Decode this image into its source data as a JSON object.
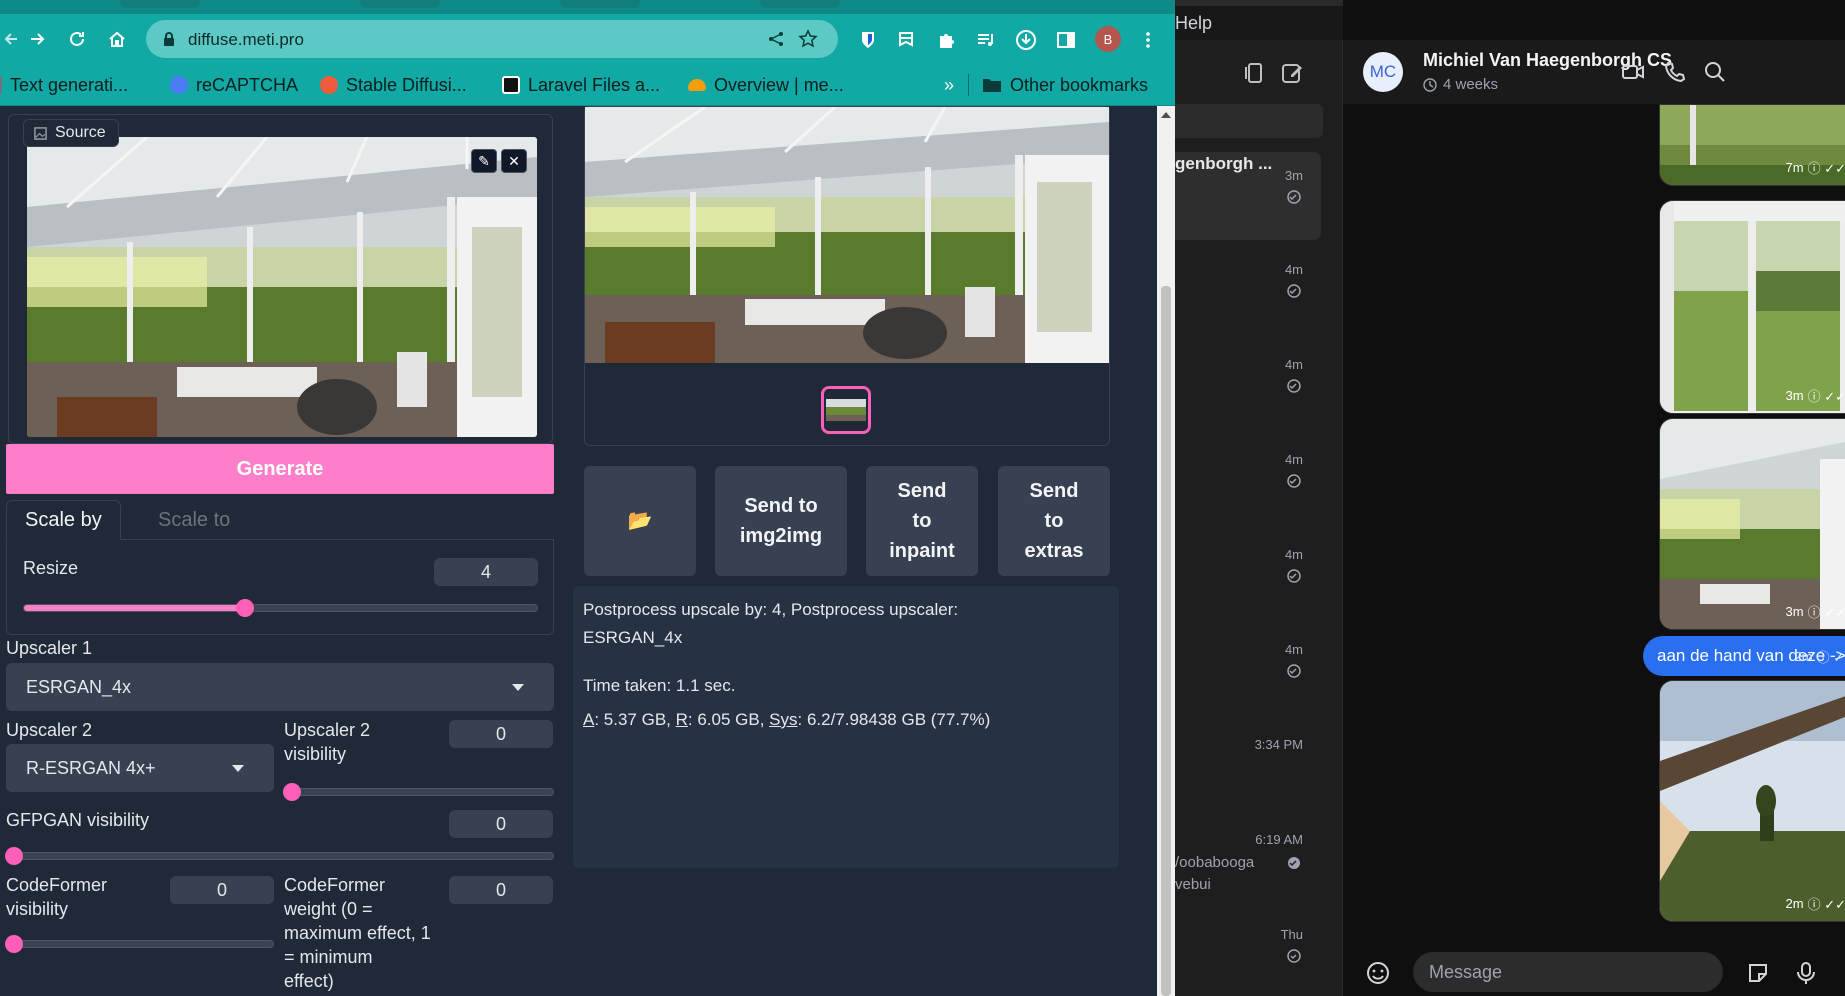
{
  "browser": {
    "url": "diffuse.meti.pro",
    "profile_initial": "B",
    "bookmarks": [
      {
        "label": "Text generati...",
        "color": "#6b7280"
      },
      {
        "label": "reCAPTCHA",
        "color": "#4a7bf2"
      },
      {
        "label": "Stable Diffusi...",
        "color": "#ef5b3d"
      },
      {
        "label": "Laravel Files a...",
        "color": "#111111"
      },
      {
        "label": "Overview | me...",
        "color": "#f59e0b"
      }
    ],
    "bookmarks_more": "»",
    "other_bookmarks": "Other bookmarks"
  },
  "webui": {
    "source_label": "Source",
    "generate_label": "Generate",
    "tabs": [
      "Scale by",
      "Scale to"
    ],
    "resize": {
      "label": "Resize",
      "value": "4",
      "level": 0.43
    },
    "upscaler1": {
      "label": "Upscaler 1",
      "value": "ESRGAN_4x"
    },
    "upscaler2": {
      "label": "Upscaler 2",
      "value": "R-ESRGAN 4x+"
    },
    "upscaler2_visibility": {
      "label_line1": "Upscaler 2",
      "label_line2": "visibility",
      "value": "0",
      "level": 0
    },
    "gfpgan": {
      "label": "GFPGAN visibility",
      "value": "0",
      "level": 0
    },
    "codeformer_vis": {
      "label_line1": "CodeFormer",
      "label_line2": "visibility",
      "value": "0",
      "level": 0
    },
    "codeformer_weight": {
      "label_lines": [
        "CodeFormer",
        "weight (0 =",
        "maximum effect, 1",
        "= minimum",
        "effect)"
      ],
      "value": "0"
    },
    "folder_icon": "📂",
    "actions": [
      {
        "line1": "Send to",
        "line2": "img2img",
        "line3": ""
      },
      {
        "line1": "Send",
        "line2": "to",
        "line3": "inpaint"
      },
      {
        "line1": "Send",
        "line2": "to",
        "line3": "extras"
      }
    ],
    "info_line1": "Postprocess upscale by: 4, Postprocess upscaler:",
    "info_line2": "ESRGAN_4x",
    "time_taken": "Time taken: 1.1 sec.",
    "mem": {
      "a_key": "A",
      "a_val": ": 5.37 GB, ",
      "r_key": "R",
      "r_val": ": 6.05 GB, ",
      "sys_key": "Sys",
      "sys_val": ": 6.2/7.98438 GB (77.7%)"
    }
  },
  "telegram": {
    "menu_help": "Help",
    "contact_name": "Michiel Van Haegenborgh CS",
    "avatar_initials": "MC",
    "status": "4 weeks",
    "chat_list": [
      {
        "name": "genborgh ...",
        "time": "3m",
        "preview": ""
      },
      {
        "name": "",
        "time": "4m",
        "preview": ""
      },
      {
        "name": "",
        "time": "4m",
        "preview": ""
      },
      {
        "name": "",
        "time": "4m",
        "preview": ""
      },
      {
        "name": "",
        "time": "4m",
        "preview": ""
      },
      {
        "name": "",
        "time": "4m",
        "preview": ""
      },
      {
        "name": "",
        "time": "3:34 PM",
        "preview": ""
      },
      {
        "name": "",
        "time": "6:19 AM",
        "preview": "/oobabooga",
        "preview2": "vebui"
      },
      {
        "name": "",
        "time": "Thu",
        "preview": ""
      }
    ],
    "messages": [
      {
        "time": "7m"
      },
      {
        "time": "3m"
      },
      {
        "time": "3m"
      },
      {
        "text": "aan de hand van deze ->",
        "time": "2m"
      },
      {
        "time": "2m"
      }
    ],
    "compose_placeholder": "Message"
  }
}
